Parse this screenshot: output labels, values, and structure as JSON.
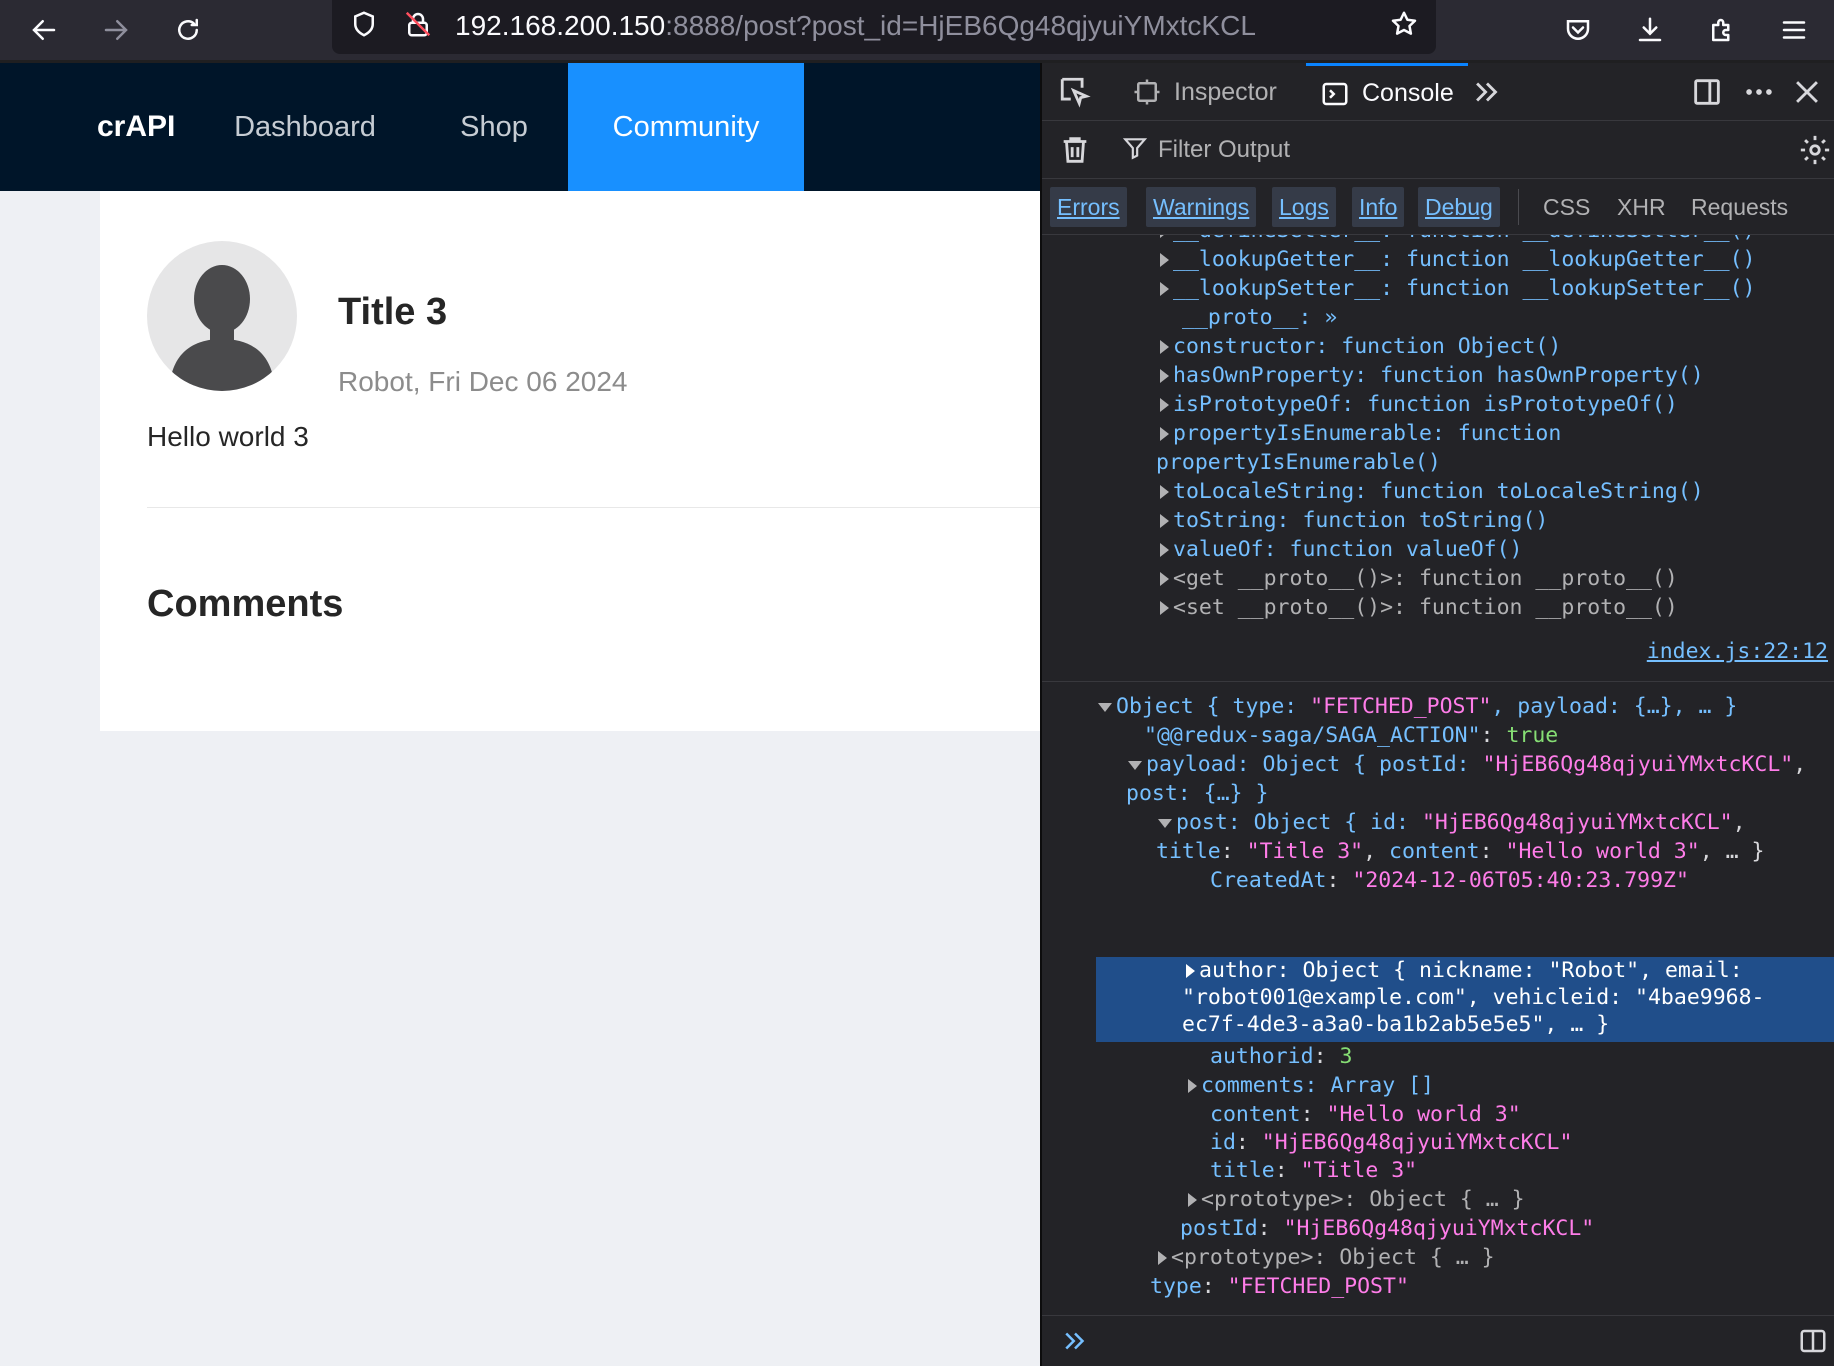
{
  "browser": {
    "url_host": "192.168.200.150",
    "url_rest": ":8888/post?post_id=HjEB6Qg48qjyuiYMxtcKCL"
  },
  "site": {
    "brand": "crAPI",
    "nav": [
      "Dashboard",
      "Shop",
      "Community"
    ],
    "active_nav": "Community"
  },
  "post": {
    "title": "Title 3",
    "meta": "Robot, Fri Dec 06 2024",
    "content": "Hello world 3",
    "comments_heading": "Comments"
  },
  "devtools": {
    "tabs": [
      "Inspector",
      "Console"
    ],
    "active_tab": "Console",
    "filter_placeholder": "Filter Output",
    "levels": [
      "Errors",
      "Warnings",
      "Logs",
      "Info",
      "Debug"
    ],
    "extra_filters": [
      "CSS",
      "XHR",
      "Requests"
    ],
    "source_link": "index.js:22:12",
    "proto_lines": [
      "__defineSetter__: function __defineSetter__()",
      "__lookupGetter__: function __lookupGetter__()",
      "__lookupSetter__: function __lookupSetter__()",
      "__proto__: »",
      "constructor: function Object()",
      "hasOwnProperty: function hasOwnProperty()",
      "isPrototypeOf: function isPrototypeOf()",
      "propertyIsEnumerable: function",
      "propertyIsEnumerable()",
      "toLocaleString: function toLocaleString()",
      "toString: function toString()",
      "valueOf: function valueOf()",
      "<get __proto__()>: function __proto__()",
      "<set __proto__()>: function __proto__()"
    ],
    "object_log": {
      "summary_key": "Object { type: ",
      "type_value": "\"FETCHED_POST\"",
      "summary_tail": ", payload: {…}, … }",
      "saga_key": "\"@@redux-saga/SAGA_ACTION\"",
      "saga_value": "true",
      "payload_head": "payload: Object { postId: ",
      "post_id_str": "\"HjEB6Qg48qjyuiYMxtcKCL\"",
      "payload_tail": "post: {…} }",
      "post_head": "post: Object { id: ",
      "post_title_str": "\"Title 3\"",
      "post_content_str": "\"Hello world 3\"",
      "created_at_key": "CreatedAt",
      "created_at_value": "\"2024-12-06T05:40:23.799Z\"",
      "author_line_1": "author: Object { nickname: \"Robot\", email:",
      "author_line_2": "\"robot001@example.com\", vehicleid: \"4bae9968-",
      "author_line_3": "ec7f-4de3-a3a0-ba1b2ab5e5e5\", … }",
      "authorid_key": "authorid",
      "authorid_value": "3",
      "comments_line": "comments: Array []",
      "content_key": "content",
      "id_key": "id",
      "title_key": "title",
      "prototype_text": "<prototype>: Object { … }",
      "postid_key": "postId",
      "type_key": "type"
    }
  }
}
